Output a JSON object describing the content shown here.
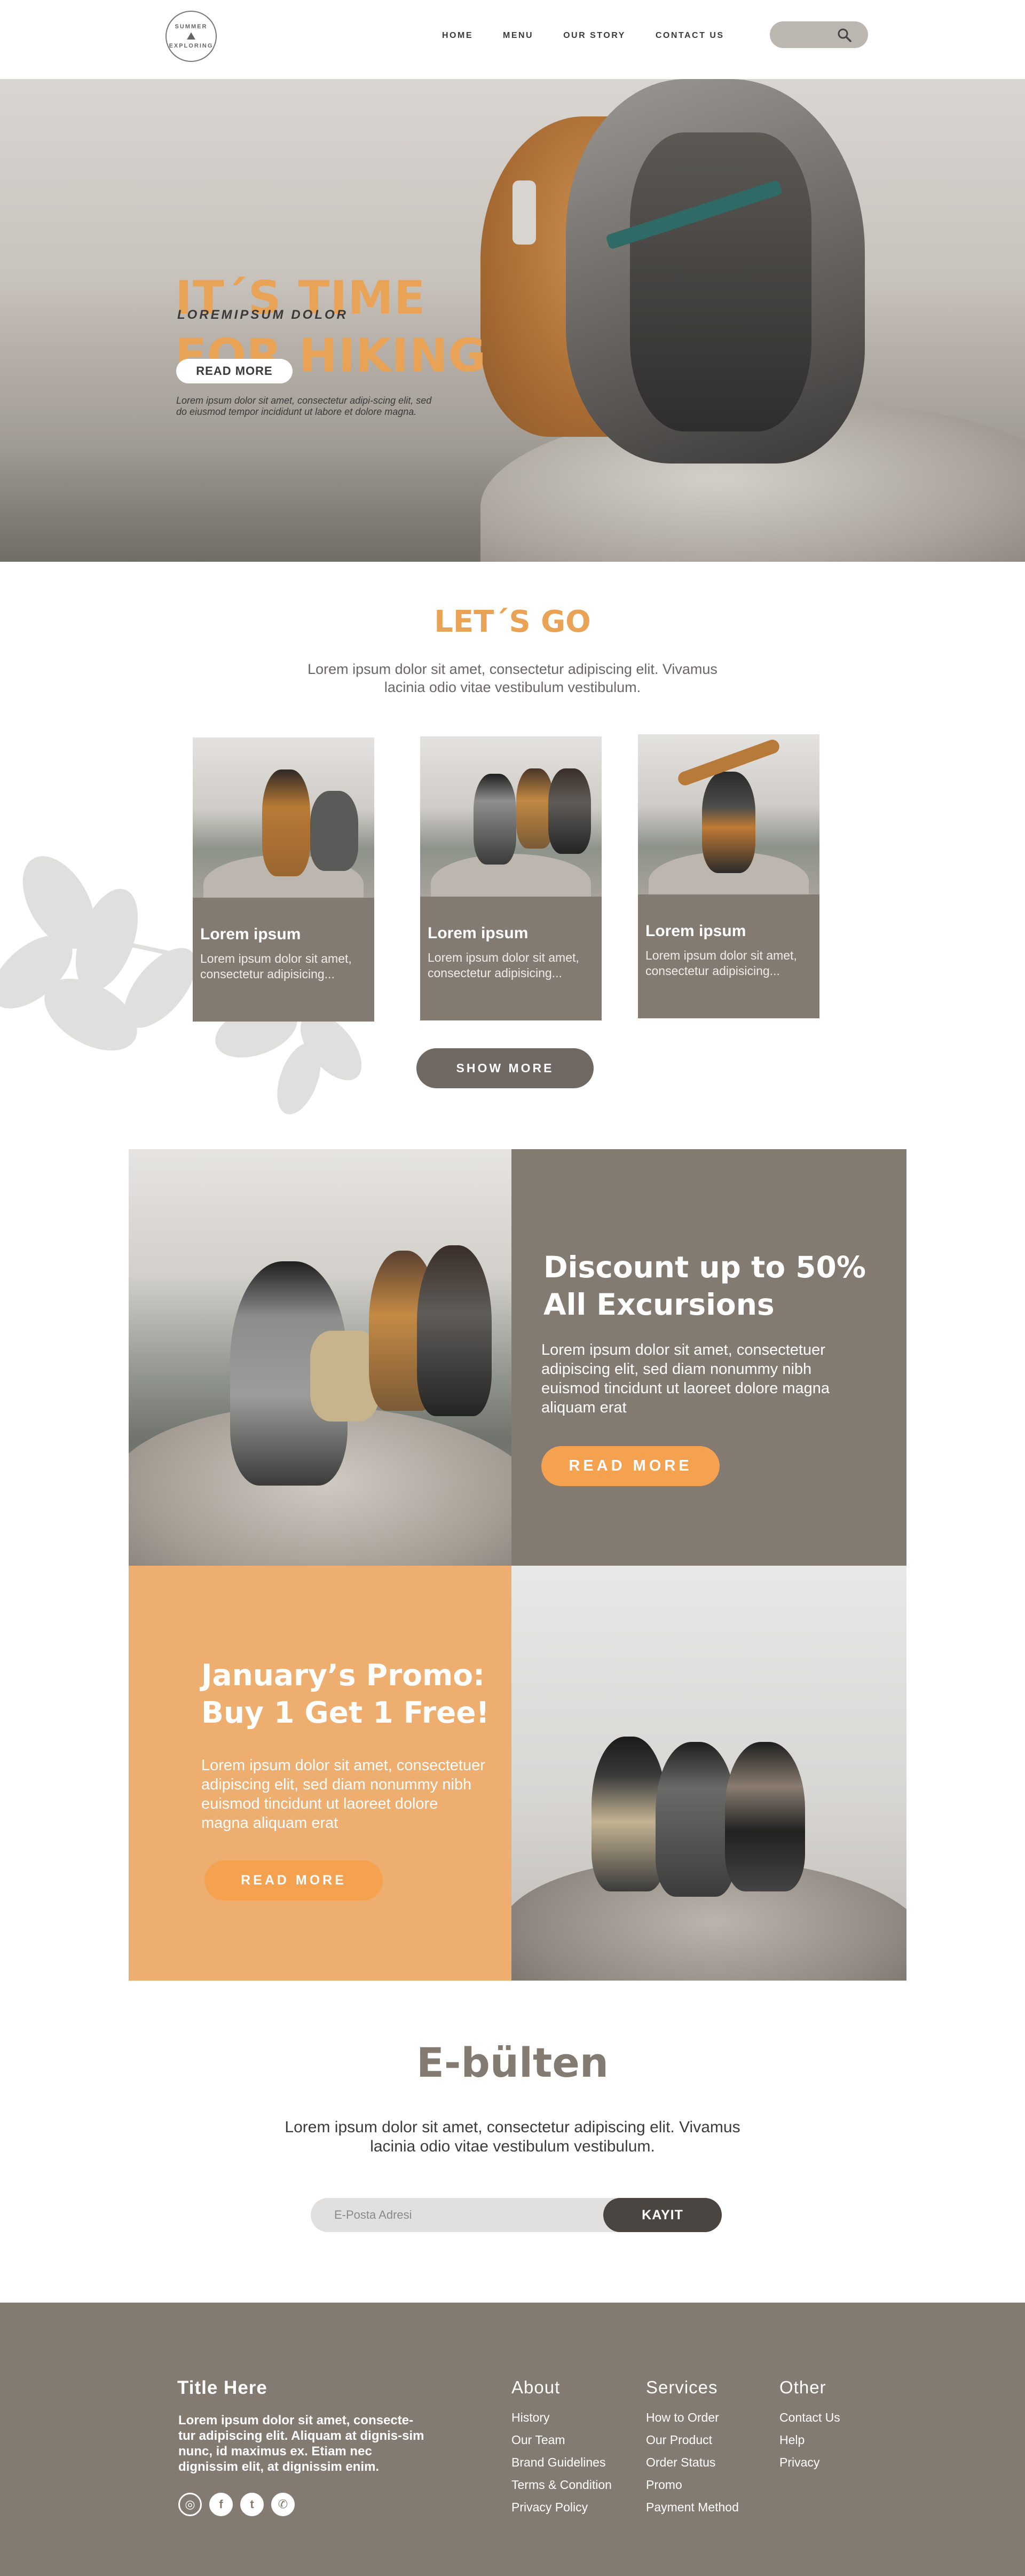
{
  "nav": {
    "logo": {
      "top": "SUMMER",
      "bottom": "EXPLORING"
    },
    "links": [
      "HOME",
      "MENU",
      "OUR STORY",
      "CONTACT US"
    ]
  },
  "hero": {
    "title_line1": "IT´S TIME",
    "title_line2": "FOR HIKING",
    "subtitle": "LOREMIPSUM DOLOR",
    "button": "READ MORE",
    "text": "Lorem ipsum dolor sit amet, consectetur adipi-scing elit, sed do eiusmod tempor incididunt ut labore et dolore magna."
  },
  "letsgo": {
    "title": "LET´S GO",
    "text": "Lorem ipsum dolor sit amet, consectetur adipiscing elit. Vivamus lacinia odio vitae vestibulum vestibulum.",
    "cards": [
      {
        "title": "Lorem ipsum",
        "text": "Lorem ipsum dolor sit amet, consectetur  adipisicing..."
      },
      {
        "title": "Lorem ipsum",
        "text": "Lorem ipsum dolor sit amet, consectetur  adipisicing..."
      },
      {
        "title": "Lorem ipsum",
        "text": "Lorem ipsum dolor sit amet, consectetur  adipisicing..."
      }
    ],
    "show_more": "SHOW MORE"
  },
  "discount": {
    "title": "Discount up to 50% All Excursions",
    "text": "Lorem ipsum dolor sit amet, consectetuer adipiscing elit, sed diam nonummy nibh euismod tincidunt ut laoreet dolore magna aliquam erat",
    "button": "READ MORE"
  },
  "january": {
    "title": "January’s Promo: Buy 1 Get 1 Free!",
    "text": "Lorem ipsum dolor sit amet, consectetuer adipiscing elit, sed diam nonummy nibh euismod tincidunt ut laoreet dolore magna aliquam erat",
    "button": "READ MORE"
  },
  "newsletter": {
    "title": "E-bülten",
    "text": "Lorem ipsum dolor sit amet, consectetur adipiscing elit. Vivamus lacinia odio vitae vestibulum vestibulum.",
    "placeholder": "E-Posta Adresi",
    "button": "KAYIT"
  },
  "footer": {
    "title": "Title Here",
    "text": "Lorem ipsum dolor sit amet, consecte-tur adipiscing elit. Aliquam at dignis-sim nunc, id maximus ex. Etiam nec dignissim elit, at dignissim enim.",
    "social_icons": [
      "instagram-icon",
      "facebook-icon",
      "twitter-icon",
      "whatsapp-icon"
    ],
    "columns": [
      {
        "heading": "About",
        "links": [
          "History",
          "Our Team",
          "Brand Guidelines",
          "Terms & Condition",
          "Privacy Policy"
        ]
      },
      {
        "heading": "Services",
        "links": [
          "How to Order",
          "Our Product",
          "Order Status",
          "Promo",
          "Payment Method"
        ]
      },
      {
        "heading": "Other",
        "links": [
          "Contact Us",
          "Help",
          "Privacy"
        ]
      }
    ]
  },
  "colors": {
    "accent_orange": "#e9a357",
    "button_orange": "#f4a24f",
    "taupe": "#837a72",
    "dark_button": "#4b4542"
  }
}
